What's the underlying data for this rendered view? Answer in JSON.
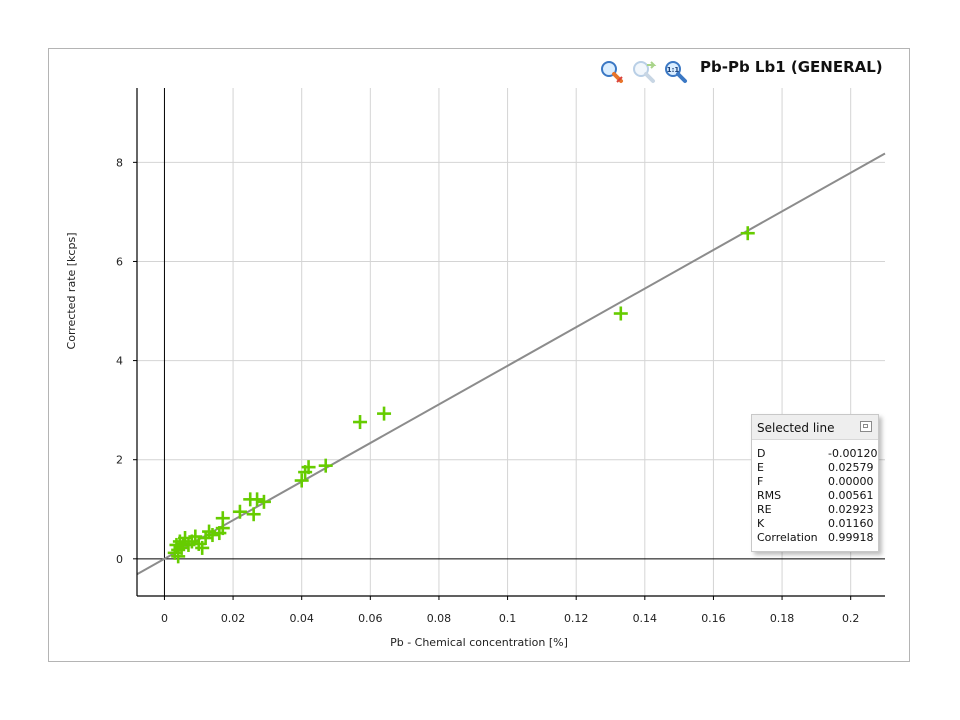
{
  "chart_title": "Pb-Pb Lb1 (GENERAL)",
  "toolbar": {
    "icons": [
      "zoom-in-icon",
      "zoom-undo-icon",
      "zoom-reset-icon"
    ],
    "reset_label": "1:1"
  },
  "chart_data": {
    "type": "scatter",
    "title": "Pb-Pb Lb1 (GENERAL)",
    "xlabel": "Pb - Chemical concentration [%]",
    "ylabel": "Corrected rate [kcps]",
    "xlim": [
      -0.008,
      0.21
    ],
    "ylim": [
      -0.75,
      9.5
    ],
    "x_ticks": [
      0,
      0.02,
      0.04,
      0.06,
      0.08,
      0.1,
      0.12,
      0.14,
      0.16,
      0.18,
      0.2
    ],
    "x_tick_labels": [
      "0",
      "0.02",
      "0.04",
      "0.06",
      "0.08",
      "0.1",
      "0.12",
      "0.14",
      "0.16",
      "0.18",
      "0.2"
    ],
    "y_ticks": [
      0,
      2,
      4,
      6,
      8
    ],
    "y_tick_labels": [
      "0",
      "2",
      "4",
      "6",
      "8"
    ],
    "grid": true,
    "marker": "plus",
    "marker_color": "#66cc00",
    "line_color": "#8c8c8c",
    "fit_line": {
      "slope": 38.95,
      "intercept": 0.0
    },
    "points": [
      {
        "x": 0.003,
        "y": 0.12
      },
      {
        "x": 0.0035,
        "y": 0.28
      },
      {
        "x": 0.004,
        "y": 0.05
      },
      {
        "x": 0.004,
        "y": 0.18
      },
      {
        "x": 0.0045,
        "y": 0.35
      },
      {
        "x": 0.005,
        "y": 0.22
      },
      {
        "x": 0.0055,
        "y": 0.3
      },
      {
        "x": 0.006,
        "y": 0.42
      },
      {
        "x": 0.007,
        "y": 0.28
      },
      {
        "x": 0.008,
        "y": 0.35
      },
      {
        "x": 0.009,
        "y": 0.45
      },
      {
        "x": 0.01,
        "y": 0.3
      },
      {
        "x": 0.011,
        "y": 0.22
      },
      {
        "x": 0.012,
        "y": 0.42
      },
      {
        "x": 0.013,
        "y": 0.55
      },
      {
        "x": 0.014,
        "y": 0.48
      },
      {
        "x": 0.016,
        "y": 0.52
      },
      {
        "x": 0.017,
        "y": 0.62
      },
      {
        "x": 0.017,
        "y": 0.82
      },
      {
        "x": 0.022,
        "y": 0.95
      },
      {
        "x": 0.025,
        "y": 1.2
      },
      {
        "x": 0.026,
        "y": 0.9
      },
      {
        "x": 0.027,
        "y": 1.2
      },
      {
        "x": 0.029,
        "y": 1.15
      },
      {
        "x": 0.04,
        "y": 1.58
      },
      {
        "x": 0.041,
        "y": 1.75
      },
      {
        "x": 0.042,
        "y": 1.85
      },
      {
        "x": 0.047,
        "y": 1.88
      },
      {
        "x": 0.057,
        "y": 2.76
      },
      {
        "x": 0.064,
        "y": 2.93
      },
      {
        "x": 0.133,
        "y": 4.95
      },
      {
        "x": 0.17,
        "y": 6.57
      }
    ]
  },
  "info_panel": {
    "title": "Selected line",
    "rows": [
      {
        "key": "D",
        "value": "-0.00120"
      },
      {
        "key": "E",
        "value": "0.02579"
      },
      {
        "key": "F",
        "value": "0.00000"
      },
      {
        "key": "RMS",
        "value": "0.00561"
      },
      {
        "key": "RE",
        "value": "0.02923"
      },
      {
        "key": "K",
        "value": "0.01160"
      },
      {
        "key": "Correlation",
        "value": "0.99918"
      }
    ]
  }
}
